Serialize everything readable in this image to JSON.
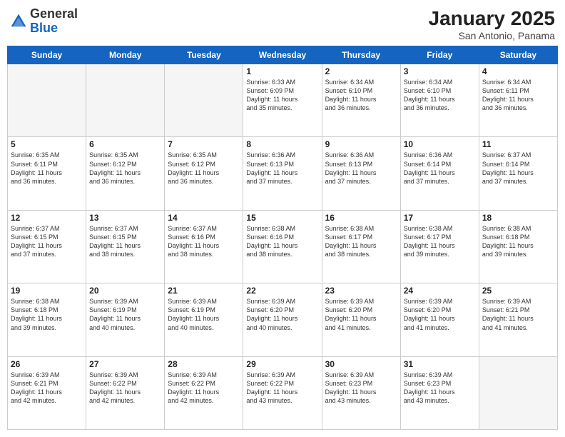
{
  "header": {
    "logo_general": "General",
    "logo_blue": "Blue",
    "title": "January 2025",
    "subtitle": "San Antonio, Panama"
  },
  "weekdays": [
    "Sunday",
    "Monday",
    "Tuesday",
    "Wednesday",
    "Thursday",
    "Friday",
    "Saturday"
  ],
  "weeks": [
    [
      {
        "day": "",
        "info": ""
      },
      {
        "day": "",
        "info": ""
      },
      {
        "day": "",
        "info": ""
      },
      {
        "day": "1",
        "info": "Sunrise: 6:33 AM\nSunset: 6:09 PM\nDaylight: 11 hours\nand 35 minutes."
      },
      {
        "day": "2",
        "info": "Sunrise: 6:34 AM\nSunset: 6:10 PM\nDaylight: 11 hours\nand 36 minutes."
      },
      {
        "day": "3",
        "info": "Sunrise: 6:34 AM\nSunset: 6:10 PM\nDaylight: 11 hours\nand 36 minutes."
      },
      {
        "day": "4",
        "info": "Sunrise: 6:34 AM\nSunset: 6:11 PM\nDaylight: 11 hours\nand 36 minutes."
      }
    ],
    [
      {
        "day": "5",
        "info": "Sunrise: 6:35 AM\nSunset: 6:11 PM\nDaylight: 11 hours\nand 36 minutes."
      },
      {
        "day": "6",
        "info": "Sunrise: 6:35 AM\nSunset: 6:12 PM\nDaylight: 11 hours\nand 36 minutes."
      },
      {
        "day": "7",
        "info": "Sunrise: 6:35 AM\nSunset: 6:12 PM\nDaylight: 11 hours\nand 36 minutes."
      },
      {
        "day": "8",
        "info": "Sunrise: 6:36 AM\nSunset: 6:13 PM\nDaylight: 11 hours\nand 37 minutes."
      },
      {
        "day": "9",
        "info": "Sunrise: 6:36 AM\nSunset: 6:13 PM\nDaylight: 11 hours\nand 37 minutes."
      },
      {
        "day": "10",
        "info": "Sunrise: 6:36 AM\nSunset: 6:14 PM\nDaylight: 11 hours\nand 37 minutes."
      },
      {
        "day": "11",
        "info": "Sunrise: 6:37 AM\nSunset: 6:14 PM\nDaylight: 11 hours\nand 37 minutes."
      }
    ],
    [
      {
        "day": "12",
        "info": "Sunrise: 6:37 AM\nSunset: 6:15 PM\nDaylight: 11 hours\nand 37 minutes."
      },
      {
        "day": "13",
        "info": "Sunrise: 6:37 AM\nSunset: 6:15 PM\nDaylight: 11 hours\nand 38 minutes."
      },
      {
        "day": "14",
        "info": "Sunrise: 6:37 AM\nSunset: 6:16 PM\nDaylight: 11 hours\nand 38 minutes."
      },
      {
        "day": "15",
        "info": "Sunrise: 6:38 AM\nSunset: 6:16 PM\nDaylight: 11 hours\nand 38 minutes."
      },
      {
        "day": "16",
        "info": "Sunrise: 6:38 AM\nSunset: 6:17 PM\nDaylight: 11 hours\nand 38 minutes."
      },
      {
        "day": "17",
        "info": "Sunrise: 6:38 AM\nSunset: 6:17 PM\nDaylight: 11 hours\nand 39 minutes."
      },
      {
        "day": "18",
        "info": "Sunrise: 6:38 AM\nSunset: 6:18 PM\nDaylight: 11 hours\nand 39 minutes."
      }
    ],
    [
      {
        "day": "19",
        "info": "Sunrise: 6:38 AM\nSunset: 6:18 PM\nDaylight: 11 hours\nand 39 minutes."
      },
      {
        "day": "20",
        "info": "Sunrise: 6:39 AM\nSunset: 6:19 PM\nDaylight: 11 hours\nand 40 minutes."
      },
      {
        "day": "21",
        "info": "Sunrise: 6:39 AM\nSunset: 6:19 PM\nDaylight: 11 hours\nand 40 minutes."
      },
      {
        "day": "22",
        "info": "Sunrise: 6:39 AM\nSunset: 6:20 PM\nDaylight: 11 hours\nand 40 minutes."
      },
      {
        "day": "23",
        "info": "Sunrise: 6:39 AM\nSunset: 6:20 PM\nDaylight: 11 hours\nand 41 minutes."
      },
      {
        "day": "24",
        "info": "Sunrise: 6:39 AM\nSunset: 6:20 PM\nDaylight: 11 hours\nand 41 minutes."
      },
      {
        "day": "25",
        "info": "Sunrise: 6:39 AM\nSunset: 6:21 PM\nDaylight: 11 hours\nand 41 minutes."
      }
    ],
    [
      {
        "day": "26",
        "info": "Sunrise: 6:39 AM\nSunset: 6:21 PM\nDaylight: 11 hours\nand 42 minutes."
      },
      {
        "day": "27",
        "info": "Sunrise: 6:39 AM\nSunset: 6:22 PM\nDaylight: 11 hours\nand 42 minutes."
      },
      {
        "day": "28",
        "info": "Sunrise: 6:39 AM\nSunset: 6:22 PM\nDaylight: 11 hours\nand 42 minutes."
      },
      {
        "day": "29",
        "info": "Sunrise: 6:39 AM\nSunset: 6:22 PM\nDaylight: 11 hours\nand 43 minutes."
      },
      {
        "day": "30",
        "info": "Sunrise: 6:39 AM\nSunset: 6:23 PM\nDaylight: 11 hours\nand 43 minutes."
      },
      {
        "day": "31",
        "info": "Sunrise: 6:39 AM\nSunset: 6:23 PM\nDaylight: 11 hours\nand 43 minutes."
      },
      {
        "day": "",
        "info": ""
      }
    ]
  ]
}
